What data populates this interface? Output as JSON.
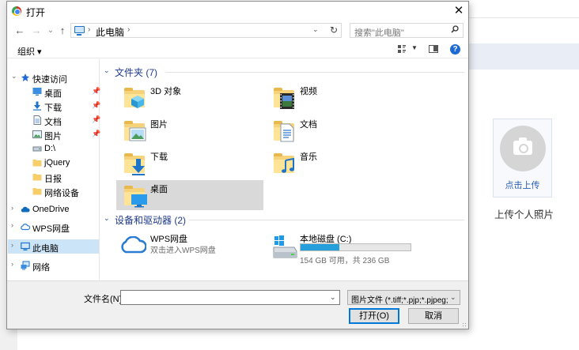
{
  "background": {
    "upload_button": "点击上传",
    "upload_caption": "上传个人照片"
  },
  "dialog": {
    "title": "打开",
    "close_label": "✕",
    "nav": {
      "back": "←",
      "forward": "→",
      "recent": "⌄",
      "up": "↑"
    },
    "address": {
      "segment": "此电脑"
    },
    "search": {
      "placeholder": "搜索\"此电脑\""
    },
    "toolbar": {
      "organize": "组织 ▾",
      "help": "?"
    },
    "sidebar": {
      "quick_access": "快速访问",
      "items": [
        {
          "label": "桌面",
          "icon": "desktop-icon",
          "pinned": true
        },
        {
          "label": "下载",
          "icon": "download-icon",
          "pinned": true
        },
        {
          "label": "文档",
          "icon": "document-icon",
          "pinned": true
        },
        {
          "label": "图片",
          "icon": "picture-icon",
          "pinned": true
        },
        {
          "label": "D:\\",
          "icon": "drive-icon",
          "pinned": false
        },
        {
          "label": "jQuery",
          "icon": "folder-icon",
          "pinned": false
        },
        {
          "label": "日报",
          "icon": "folder-icon",
          "pinned": false
        },
        {
          "label": "网络设备",
          "icon": "folder-icon",
          "pinned": false
        }
      ],
      "roots": [
        {
          "label": "OneDrive",
          "icon": "onedrive-icon"
        },
        {
          "label": "WPS网盘",
          "icon": "wps-cloud-icon"
        },
        {
          "label": "此电脑",
          "icon": "this-pc-icon",
          "selected": true
        },
        {
          "label": "网络",
          "icon": "network-icon"
        }
      ]
    },
    "content": {
      "folders_header": "文件夹 (7)",
      "folders": [
        {
          "name": "3D 对象",
          "overlay": "3d-objects-icon"
        },
        {
          "name": "视频",
          "overlay": "video-icon"
        },
        {
          "name": "图片",
          "overlay": "picture-icon"
        },
        {
          "name": "文档",
          "overlay": "document-icon"
        },
        {
          "name": "下载",
          "overlay": "download-icon"
        },
        {
          "name": "音乐",
          "overlay": "music-icon"
        },
        {
          "name": "桌面",
          "overlay": "desktop-icon",
          "selected": true
        }
      ],
      "devices_header": "设备和驱动器 (2)",
      "devices": [
        {
          "name": "WPS网盘",
          "subtitle": "双击进入WPS网盘",
          "icon": "wps-cloud-icon"
        },
        {
          "name": "本地磁盘 (C:)",
          "free_text": "154 GB 可用，共 236 GB",
          "used_fraction": 0.35,
          "icon": "local-disk-icon"
        }
      ]
    },
    "footer": {
      "filename_label": "文件名(N):",
      "filename_value": "",
      "filetype": "图片文件 (*.tiff;*.pjp;*.pjpeg;*.",
      "open_button": "打开(O)",
      "cancel_button": "取消"
    }
  },
  "colors": {
    "selection": "#cce4f7",
    "accent": "#0078d7",
    "group_header": "#1e3a8a",
    "drive_bar": "#26a0da"
  }
}
